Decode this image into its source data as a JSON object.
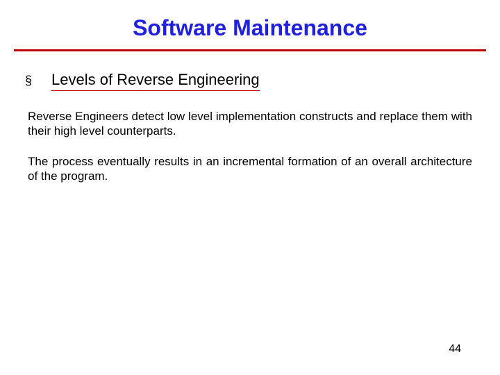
{
  "slide": {
    "title": "Software Maintenance",
    "bullet_marker": "§",
    "subheading": "Levels of Reverse Engineering",
    "paragraph1": "Reverse Engineers detect low level implementation constructs and replace them with their high level counterparts.",
    "paragraph2": "The process eventually results in an incremental formation of an overall architecture of the program.",
    "page_number": "44"
  }
}
